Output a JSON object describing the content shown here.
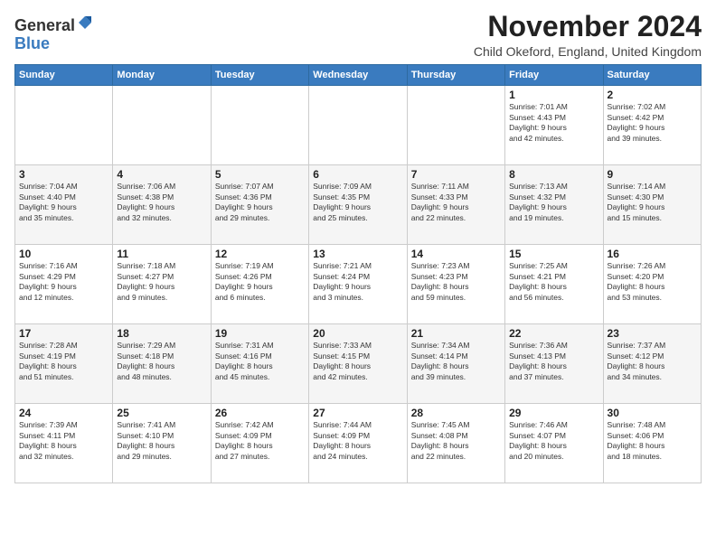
{
  "header": {
    "logo_general": "General",
    "logo_blue": "Blue",
    "month_title": "November 2024",
    "subtitle": "Child Okeford, England, United Kingdom"
  },
  "weekdays": [
    "Sunday",
    "Monday",
    "Tuesday",
    "Wednesday",
    "Thursday",
    "Friday",
    "Saturday"
  ],
  "weeks": [
    [
      {
        "day": "",
        "info": ""
      },
      {
        "day": "",
        "info": ""
      },
      {
        "day": "",
        "info": ""
      },
      {
        "day": "",
        "info": ""
      },
      {
        "day": "",
        "info": ""
      },
      {
        "day": "1",
        "info": "Sunrise: 7:01 AM\nSunset: 4:43 PM\nDaylight: 9 hours\nand 42 minutes."
      },
      {
        "day": "2",
        "info": "Sunrise: 7:02 AM\nSunset: 4:42 PM\nDaylight: 9 hours\nand 39 minutes."
      }
    ],
    [
      {
        "day": "3",
        "info": "Sunrise: 7:04 AM\nSunset: 4:40 PM\nDaylight: 9 hours\nand 35 minutes."
      },
      {
        "day": "4",
        "info": "Sunrise: 7:06 AM\nSunset: 4:38 PM\nDaylight: 9 hours\nand 32 minutes."
      },
      {
        "day": "5",
        "info": "Sunrise: 7:07 AM\nSunset: 4:36 PM\nDaylight: 9 hours\nand 29 minutes."
      },
      {
        "day": "6",
        "info": "Sunrise: 7:09 AM\nSunset: 4:35 PM\nDaylight: 9 hours\nand 25 minutes."
      },
      {
        "day": "7",
        "info": "Sunrise: 7:11 AM\nSunset: 4:33 PM\nDaylight: 9 hours\nand 22 minutes."
      },
      {
        "day": "8",
        "info": "Sunrise: 7:13 AM\nSunset: 4:32 PM\nDaylight: 9 hours\nand 19 minutes."
      },
      {
        "day": "9",
        "info": "Sunrise: 7:14 AM\nSunset: 4:30 PM\nDaylight: 9 hours\nand 15 minutes."
      }
    ],
    [
      {
        "day": "10",
        "info": "Sunrise: 7:16 AM\nSunset: 4:29 PM\nDaylight: 9 hours\nand 12 minutes."
      },
      {
        "day": "11",
        "info": "Sunrise: 7:18 AM\nSunset: 4:27 PM\nDaylight: 9 hours\nand 9 minutes."
      },
      {
        "day": "12",
        "info": "Sunrise: 7:19 AM\nSunset: 4:26 PM\nDaylight: 9 hours\nand 6 minutes."
      },
      {
        "day": "13",
        "info": "Sunrise: 7:21 AM\nSunset: 4:24 PM\nDaylight: 9 hours\nand 3 minutes."
      },
      {
        "day": "14",
        "info": "Sunrise: 7:23 AM\nSunset: 4:23 PM\nDaylight: 8 hours\nand 59 minutes."
      },
      {
        "day": "15",
        "info": "Sunrise: 7:25 AM\nSunset: 4:21 PM\nDaylight: 8 hours\nand 56 minutes."
      },
      {
        "day": "16",
        "info": "Sunrise: 7:26 AM\nSunset: 4:20 PM\nDaylight: 8 hours\nand 53 minutes."
      }
    ],
    [
      {
        "day": "17",
        "info": "Sunrise: 7:28 AM\nSunset: 4:19 PM\nDaylight: 8 hours\nand 51 minutes."
      },
      {
        "day": "18",
        "info": "Sunrise: 7:29 AM\nSunset: 4:18 PM\nDaylight: 8 hours\nand 48 minutes."
      },
      {
        "day": "19",
        "info": "Sunrise: 7:31 AM\nSunset: 4:16 PM\nDaylight: 8 hours\nand 45 minutes."
      },
      {
        "day": "20",
        "info": "Sunrise: 7:33 AM\nSunset: 4:15 PM\nDaylight: 8 hours\nand 42 minutes."
      },
      {
        "day": "21",
        "info": "Sunrise: 7:34 AM\nSunset: 4:14 PM\nDaylight: 8 hours\nand 39 minutes."
      },
      {
        "day": "22",
        "info": "Sunrise: 7:36 AM\nSunset: 4:13 PM\nDaylight: 8 hours\nand 37 minutes."
      },
      {
        "day": "23",
        "info": "Sunrise: 7:37 AM\nSunset: 4:12 PM\nDaylight: 8 hours\nand 34 minutes."
      }
    ],
    [
      {
        "day": "24",
        "info": "Sunrise: 7:39 AM\nSunset: 4:11 PM\nDaylight: 8 hours\nand 32 minutes."
      },
      {
        "day": "25",
        "info": "Sunrise: 7:41 AM\nSunset: 4:10 PM\nDaylight: 8 hours\nand 29 minutes."
      },
      {
        "day": "26",
        "info": "Sunrise: 7:42 AM\nSunset: 4:09 PM\nDaylight: 8 hours\nand 27 minutes."
      },
      {
        "day": "27",
        "info": "Sunrise: 7:44 AM\nSunset: 4:09 PM\nDaylight: 8 hours\nand 24 minutes."
      },
      {
        "day": "28",
        "info": "Sunrise: 7:45 AM\nSunset: 4:08 PM\nDaylight: 8 hours\nand 22 minutes."
      },
      {
        "day": "29",
        "info": "Sunrise: 7:46 AM\nSunset: 4:07 PM\nDaylight: 8 hours\nand 20 minutes."
      },
      {
        "day": "30",
        "info": "Sunrise: 7:48 AM\nSunset: 4:06 PM\nDaylight: 8 hours\nand 18 minutes."
      }
    ]
  ]
}
